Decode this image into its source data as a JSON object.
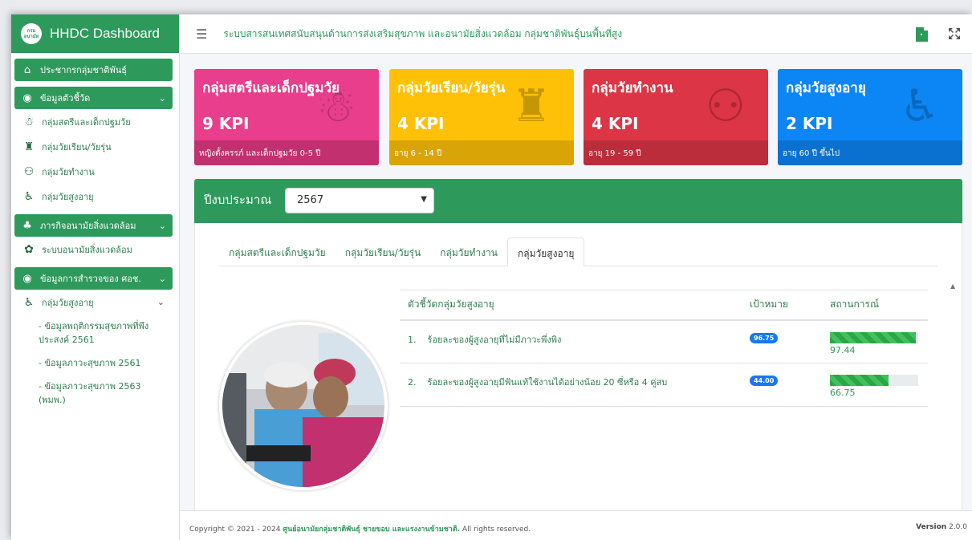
{
  "brand": {
    "logo_text": "กรมอนามัย",
    "title": "HHDC Dashboard"
  },
  "header": {
    "title": "ระบบสารสนเทศสนับสนุนด้านการส่งเสริมสุขภาพ และอนามัยสิ่งแวดล้อม กลุ่มชาติพันธุ์บนพื้นที่สูง"
  },
  "sidebar": {
    "population": "ประชากรกลุ่มชาติพันธุ์",
    "indicators": "ข้อมูลตัวชี้วัด",
    "indicator_items": [
      "กลุ่มสตรีและเด็กปฐมวัย",
      "กลุ่มวัยเรียน/วัยรุ่น",
      "กลุ่มวัยทำงาน",
      "กลุ่มวัยสูงอายุ"
    ],
    "env": "ภารกิจอนามัยสิ่งแวดล้อม",
    "env_item": "ระบบอนามัยสิ่งแวดล้อม",
    "survey": "ข้อมูลการสำรวจของ ศอช.",
    "survey_group": "กลุ่มวัยสูงอายุ",
    "survey_subs": [
      "- ข้อมูลพฤติกรรมสุขภาพที่พึงประสงค์ 2561",
      "- ข้อมูลภาวะสุขภาพ 2561",
      "- ข้อมูลภาวะสุขภาพ 2563 (พมพ.)"
    ]
  },
  "kpis": [
    {
      "title": "กลุ่มสตรีและเด็กปฐมวัย",
      "value": "9 KPI",
      "desc": "หญิงตั้งครรภ์ และเด็กปฐมวัย 0-5 ปี",
      "color": "#e83e8c",
      "footer_color": "#c2306f",
      "icon": "baby-icon"
    },
    {
      "title": "กลุ่มวัยเรียน/วัยรุ่น",
      "value": "4 KPI",
      "desc": "อายุ 6 - 14 ปี",
      "color": "#ffc107",
      "footer_color": "#d9a406",
      "icon": "graduate-icon"
    },
    {
      "title": "กลุ่มวัยทำงาน",
      "value": "4 KPI",
      "desc": "อายุ 19 - 59 ปี",
      "color": "#dc3545",
      "footer_color": "#bb2d3b",
      "icon": "workers-icon"
    },
    {
      "title": "กลุ่มวัยสูงอายุ",
      "value": "2 KPI",
      "desc": "อายุ 60 ปี ขึ้นไป",
      "color": "#0d86f5",
      "footer_color": "#0b71d0",
      "icon": "elderly-icon"
    }
  ],
  "budget": {
    "label": "ปีงบประมาณ",
    "year": "2567"
  },
  "tabs": [
    "กลุ่มสตรีและเด็กปฐมวัย",
    "กลุ่มวัยเรียน/วัยรุ่น",
    "กลุ่มวัยทำงาน",
    "กลุ่มวัยสูงอายุ"
  ],
  "table": {
    "headers": [
      "ตัวชี้วัดกลุ่มวัยสูงอายุ",
      "เป้าหมาย",
      "สถานการณ์"
    ],
    "rows": [
      {
        "no": "1.",
        "name": "ร้อยละของผู้สูงอายุที่ไม่มีภาวะพึ่งพิง",
        "target": "96.75",
        "value": "97.44",
        "percent": 97.44
      },
      {
        "no": "2.",
        "name": "ร้อยละของผู้สูงอายุมีฟันแท้ใช้งานได้อย่างน้อย 20 ซี่หรือ 4 คู่สบ",
        "target": "44.00",
        "value": "66.75",
        "percent": 66.75
      }
    ]
  },
  "footer": {
    "prefix": "Copyright © 2021 - 2024",
    "org": "ศูนย์อนามัยกลุ่มชาติพันธุ์ ชายขอบ และแรงงานข้ามชาติ.",
    "suffix": "All rights reserved.",
    "version_label": "Version",
    "version": "2.0.0"
  }
}
